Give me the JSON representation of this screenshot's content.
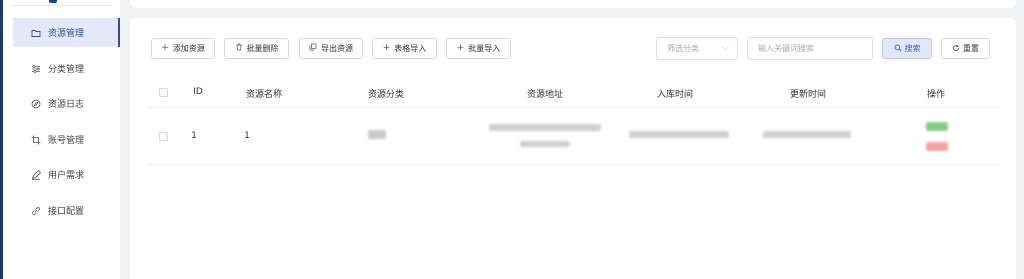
{
  "sidebar": {
    "items": [
      {
        "label": "资源管理",
        "icon": "folder-icon",
        "active": true
      },
      {
        "label": "分类管理",
        "icon": "sliders-icon",
        "active": false
      },
      {
        "label": "资源日志",
        "icon": "compass-icon",
        "active": false
      },
      {
        "label": "账号管理",
        "icon": "crop-icon",
        "active": false
      },
      {
        "label": "用户需求",
        "icon": "pencil-icon",
        "active": false
      },
      {
        "label": "接口配置",
        "icon": "link-icon",
        "active": false
      }
    ]
  },
  "toolbar": {
    "add_label": "添加资源",
    "batch_delete_label": "批量删除",
    "export_label": "导出资源",
    "table_import_label": "表格导入",
    "batch_import_label": "批量导入"
  },
  "filter": {
    "category_placeholder": "筛选分类",
    "search_placeholder": "输入关键词搜索",
    "search_label": "搜索",
    "reset_label": "重置"
  },
  "table": {
    "columns": [
      "ID",
      "资源名称",
      "资源分类",
      "资源地址",
      "入库时间",
      "更新时间",
      "操作"
    ],
    "rows": [
      {
        "id": "1",
        "name": "1"
      }
    ]
  },
  "colors": {
    "accent": "#2f4fa8",
    "sidebar_active_bg": "#e3e9f8",
    "search_button_bg": "#e1e8fb",
    "edit_action": "#5dbb63",
    "delete_action": "#e06a6a"
  }
}
